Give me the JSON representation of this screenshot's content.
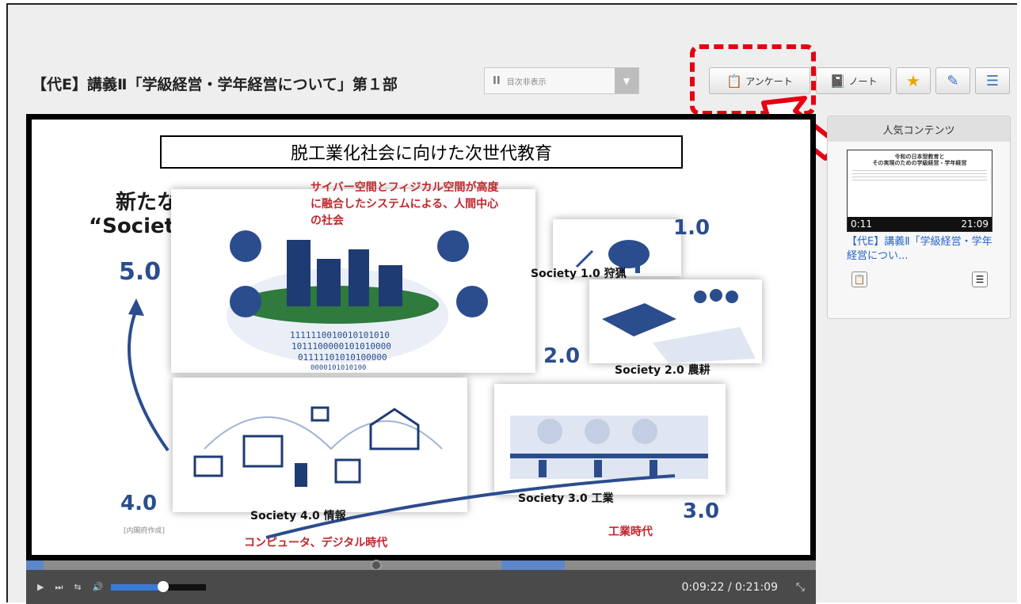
{
  "header": {
    "title": "【代E】講義Ⅱ「学級経営・学年経営について」第１部",
    "toc_select": {
      "icon": "pause-icon",
      "label": "目次非表示"
    }
  },
  "toolbar": {
    "survey_label": "アンケート",
    "note_label": "ノート",
    "highlight_color": "#e60012"
  },
  "slide": {
    "title": "脱工業化社会に向けた次世代教育",
    "headline": "新たな社会",
    "headline_sub": "“Society 5.0”",
    "desc": "サイバー空間とフィジカル空間が高度に融合したシステムによる、人間中心の社会",
    "versions": [
      "5.0",
      "1.0",
      "2.0",
      "4.0",
      "3.0"
    ],
    "captions": [
      "Society 1.0 狩猟",
      "Society 2.0 農耕",
      "Society 3.0 工業",
      "Society 4.0 情報"
    ],
    "era_industry": "工業時代",
    "era_computer": "コンピュータ、デジタル時代",
    "source": "[内閣府作成]",
    "binary": [
      "1111110010010101010",
      "1011100000101010000",
      "01111101010100000",
      "0000101010100"
    ]
  },
  "player": {
    "time_display": "0:09:22 / 0:21:09",
    "progress": 0.443,
    "volume": 0.55,
    "controls": [
      "play-icon",
      "next-icon",
      "repeat-icon",
      "volume-icon"
    ]
  },
  "sidebar": {
    "heading": "人気コンテンツ",
    "items": [
      {
        "thumb_title": "令和の日本型教育と\nその実現のための学級経営・学年経営",
        "start_time": "0:11",
        "duration": "21:09",
        "link": "【代E】講義Ⅱ「学級経営・学年経営につい..."
      }
    ]
  }
}
